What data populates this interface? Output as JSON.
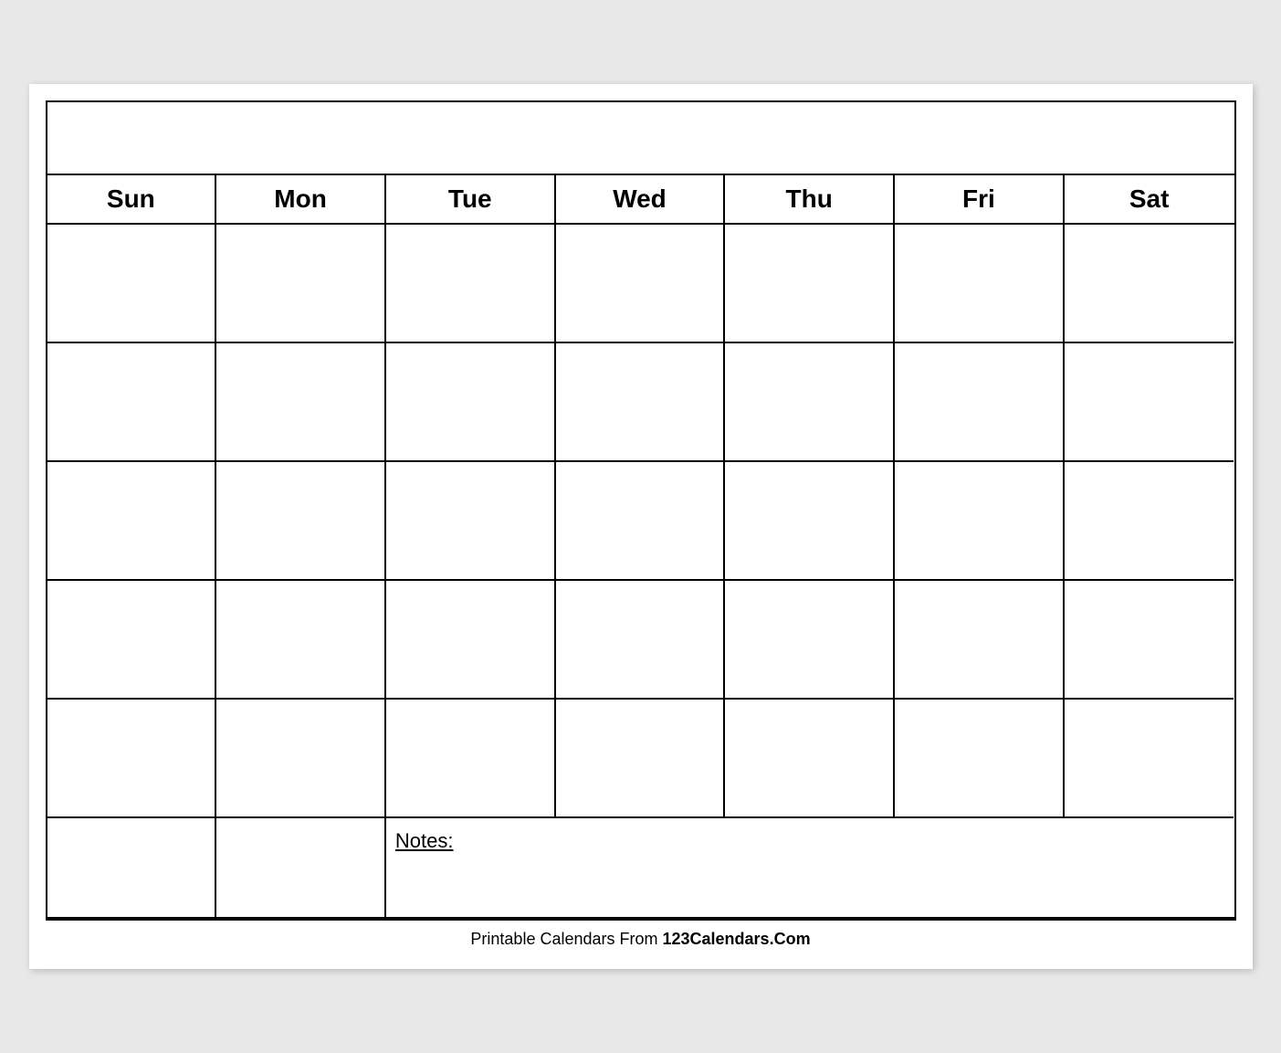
{
  "calendar": {
    "title": "",
    "days_of_week": [
      "Sun",
      "Mon",
      "Tue",
      "Wed",
      "Thu",
      "Fri",
      "Sat"
    ],
    "weeks": 5,
    "notes_label": "Notes:"
  },
  "footer": {
    "text_normal": "Printable Calendars From ",
    "text_bold": "123Calendars.Com"
  }
}
